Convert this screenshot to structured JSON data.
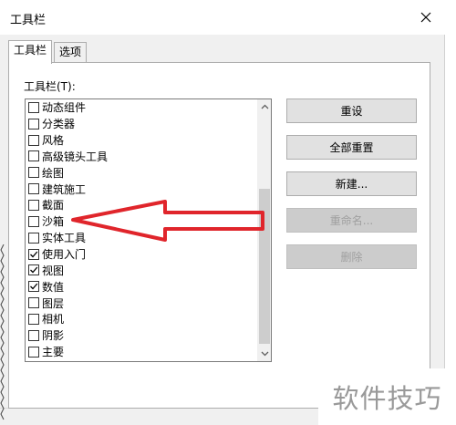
{
  "window": {
    "title": "工具栏"
  },
  "tabs": [
    {
      "label": "工具栏"
    },
    {
      "label": "选项"
    }
  ],
  "list": {
    "label": "工具栏(T):",
    "items": [
      {
        "label": "动态组件",
        "checked": false
      },
      {
        "label": "分类器",
        "checked": false
      },
      {
        "label": "风格",
        "checked": false
      },
      {
        "label": "高级镜头工具",
        "checked": false
      },
      {
        "label": "绘图",
        "checked": false
      },
      {
        "label": "建筑施工",
        "checked": false
      },
      {
        "label": "截面",
        "checked": false
      },
      {
        "label": "沙箱",
        "checked": false
      },
      {
        "label": "实体工具",
        "checked": false
      },
      {
        "label": "使用入门",
        "checked": true
      },
      {
        "label": "视图",
        "checked": true
      },
      {
        "label": "数值",
        "checked": true
      },
      {
        "label": "图层",
        "checked": false
      },
      {
        "label": "相机",
        "checked": false
      },
      {
        "label": "阴影",
        "checked": false
      },
      {
        "label": "主要",
        "checked": false
      }
    ]
  },
  "buttons": {
    "reset": "重设",
    "reset_all": "全部重置",
    "new": "新建...",
    "rename": "重命名...",
    "delete": "删除"
  },
  "watermark": "软件技巧",
  "colors": {
    "annotation_arrow": "#e0252b",
    "accent": "#0078d7"
  }
}
